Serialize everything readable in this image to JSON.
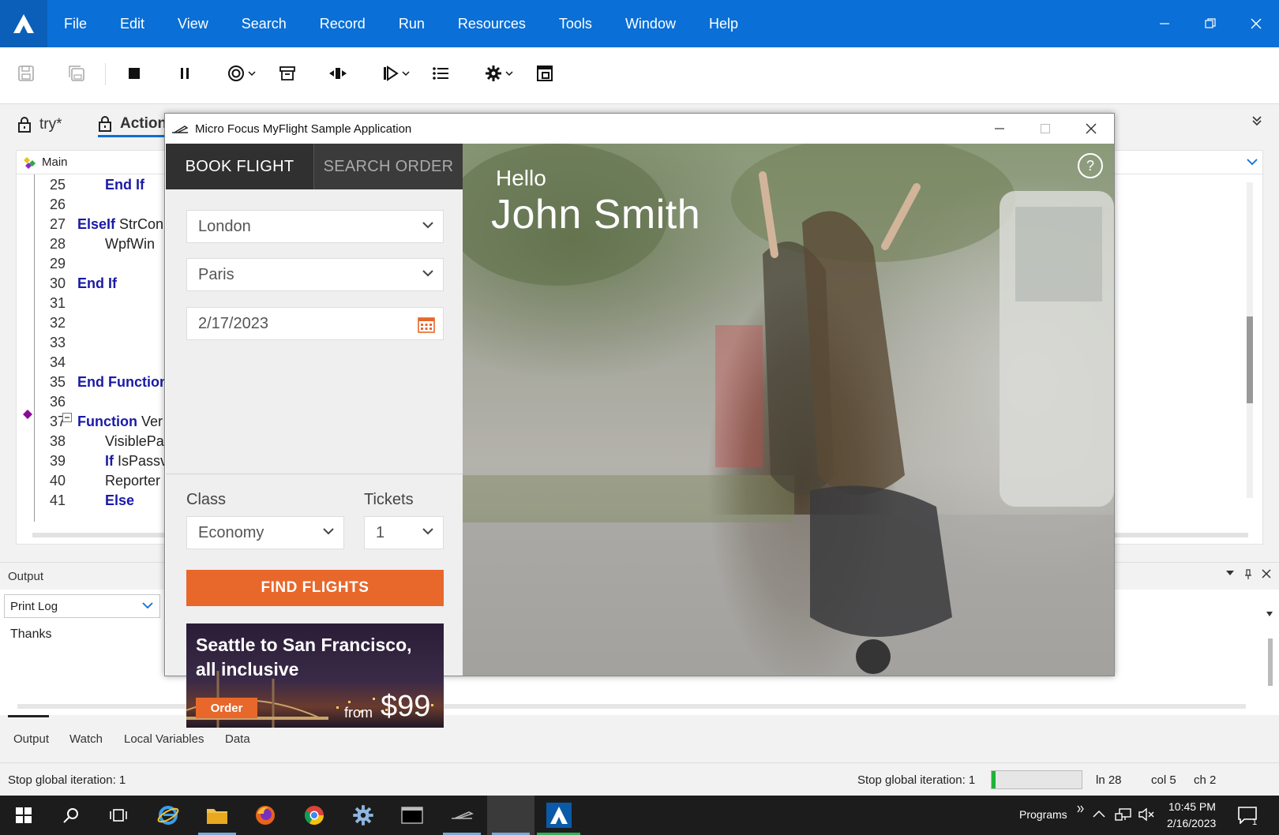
{
  "app": {
    "menu": [
      "File",
      "Edit",
      "View",
      "Search",
      "Record",
      "Run",
      "Resources",
      "Tools",
      "Window",
      "Help"
    ]
  },
  "doc_tabs": {
    "tab1": "try*",
    "tab2": "Action"
  },
  "editor": {
    "scope": "Main",
    "lines": [
      {
        "n": "25",
        "text": "End  If"
      },
      {
        "n": "26",
        "text": ""
      },
      {
        "n": "27",
        "kw": "ElseIf",
        "text": " StrCon"
      },
      {
        "n": "28",
        "text": "WpfWin"
      },
      {
        "n": "29",
        "text": ""
      },
      {
        "n": "30",
        "text": "End If"
      },
      {
        "n": "31",
        "text": ""
      },
      {
        "n": "32",
        "text": ""
      },
      {
        "n": "33",
        "text": ""
      },
      {
        "n": "34",
        "text": ""
      },
      {
        "n": "35",
        "text": "End Function"
      },
      {
        "n": "36",
        "text": ""
      },
      {
        "n": "37",
        "kw": "Function",
        "text": " Ver"
      },
      {
        "n": "38",
        "text": "VisiblePa"
      },
      {
        "n": "39",
        "kw": "If",
        "text": " IsPassv"
      },
      {
        "n": "40",
        "text": "Reporter"
      },
      {
        "n": "41",
        "text": "Else"
      }
    ]
  },
  "output": {
    "title": "Output",
    "filter": "Print Log",
    "text": "Thanks"
  },
  "bottom_tabs": [
    "Output",
    "Watch",
    "Local Variables",
    "Data"
  ],
  "status": {
    "left": "Stop global iteration: 1",
    "right": "Stop global iteration: 1",
    "progress": 0.04,
    "ln": "ln 28",
    "col": "col 5",
    "ch": "ch 2"
  },
  "taskbar": {
    "programs": "Programs",
    "time": "10:45 PM",
    "date": "2/16/2023",
    "notifications": "1"
  },
  "myflight": {
    "title": "Micro Focus MyFlight Sample Application",
    "tabs": {
      "book": "BOOK FLIGHT",
      "search": "SEARCH ORDER"
    },
    "from": "London",
    "to": "Paris",
    "date": "2/17/2023",
    "class_label": "Class",
    "class_value": "Economy",
    "tickets_label": "Tickets",
    "tickets_value": "1",
    "find_button": "FIND FLIGHTS",
    "promo": {
      "title": "Seattle to San Francisco, all inclusive",
      "order": "Order",
      "from": "from",
      "price": "$99"
    },
    "greeting": "Hello",
    "user": "John Smith",
    "help": "?"
  },
  "colors": {
    "menubar": "#0a6fd6",
    "accent_orange": "#e8672b",
    "keyword_blue": "#1a1aa6",
    "progress_green": "#1db33a"
  }
}
